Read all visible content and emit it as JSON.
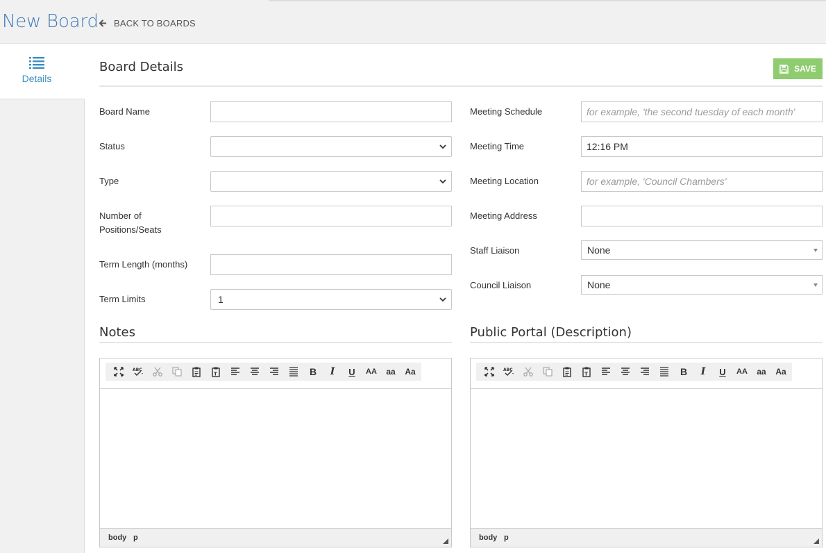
{
  "header": {
    "title": "New Board",
    "back_label": "BACK TO BOARDS"
  },
  "sidebar": {
    "tabs": [
      {
        "label": "Details",
        "icon": "list-icon"
      }
    ]
  },
  "board_details": {
    "title": "Board Details",
    "save_label": "SAVE",
    "fields": {
      "board_name": {
        "label": "Board Name",
        "value": ""
      },
      "status": {
        "label": "Status",
        "value": ""
      },
      "type": {
        "label": "Type",
        "value": ""
      },
      "positions": {
        "label_line1": "Number of",
        "label_line2": "Positions/Seats",
        "value": ""
      },
      "term_length": {
        "label": "Term Length (months)",
        "value": ""
      },
      "term_limits": {
        "label": "Term Limits",
        "value": "1"
      },
      "meeting_schedule": {
        "label": "Meeting Schedule",
        "value": "",
        "placeholder": "for example, 'the second tuesday of each month'"
      },
      "meeting_time": {
        "label": "Meeting Time",
        "value": "12:16 PM"
      },
      "meeting_location": {
        "label": "Meeting Location",
        "value": "",
        "placeholder": "for example, 'Council Chambers'"
      },
      "meeting_address": {
        "label": "Meeting Address",
        "value": ""
      },
      "staff_liaison": {
        "label": "Staff Liaison",
        "value": "None"
      },
      "council_liaison": {
        "label": "Council Liaison",
        "value": "None"
      }
    }
  },
  "notes": {
    "title": "Notes",
    "status_path": [
      "body",
      "p"
    ]
  },
  "public_portal": {
    "title": "Public Portal (Description)",
    "status_path": [
      "body",
      "p"
    ]
  },
  "editor_toolbar": {
    "buttons": [
      "fullscreen",
      "spellcheck",
      "cut",
      "copy",
      "paste",
      "paste-text",
      "align-left",
      "align-center",
      "align-right",
      "justify",
      "bold",
      "italic",
      "underline",
      "uppercase",
      "lowercase",
      "capitalize"
    ],
    "text_labels": {
      "bold": "B",
      "italic": "I",
      "underline": "U",
      "uppercase": "AA",
      "lowercase": "aa",
      "capitalize": "Aa"
    }
  },
  "colors": {
    "title_blue": "#3d7ab8",
    "tab_blue": "#3d8fc0",
    "save_green": "#8ecc6f"
  }
}
